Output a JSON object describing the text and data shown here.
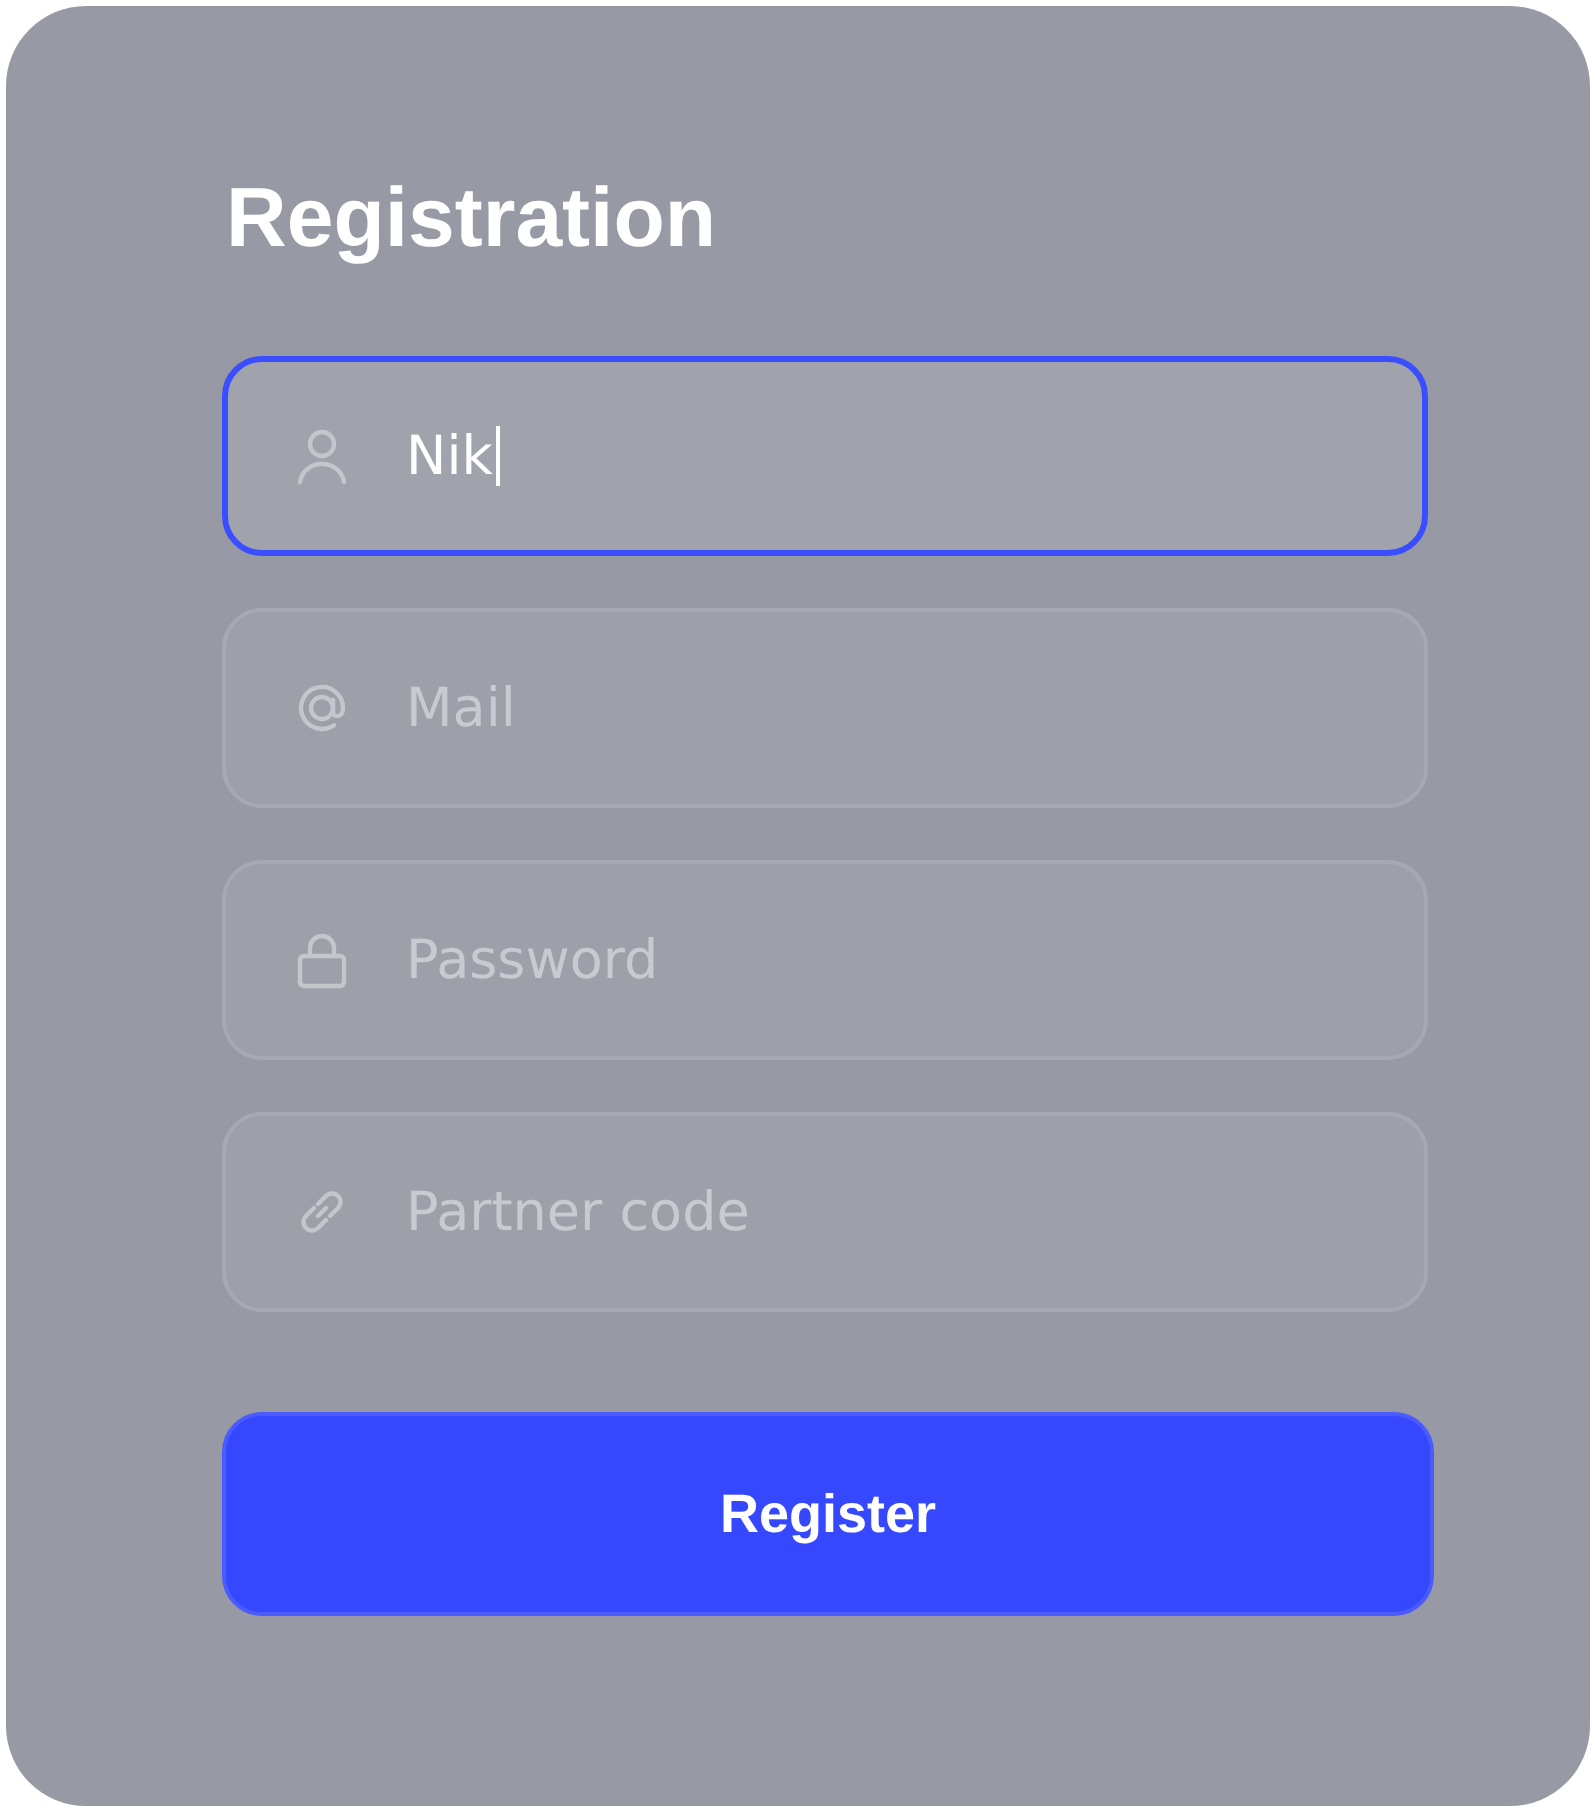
{
  "title": "Registration",
  "fields": [
    {
      "kind": "user",
      "value": "Nik",
      "focused": true
    },
    {
      "kind": "mail",
      "placeholder": "Mail",
      "focused": false
    },
    {
      "kind": "lock",
      "placeholder": "Password",
      "focused": false
    },
    {
      "kind": "link",
      "placeholder": "Partner code",
      "focused": false
    }
  ],
  "button": "Register"
}
